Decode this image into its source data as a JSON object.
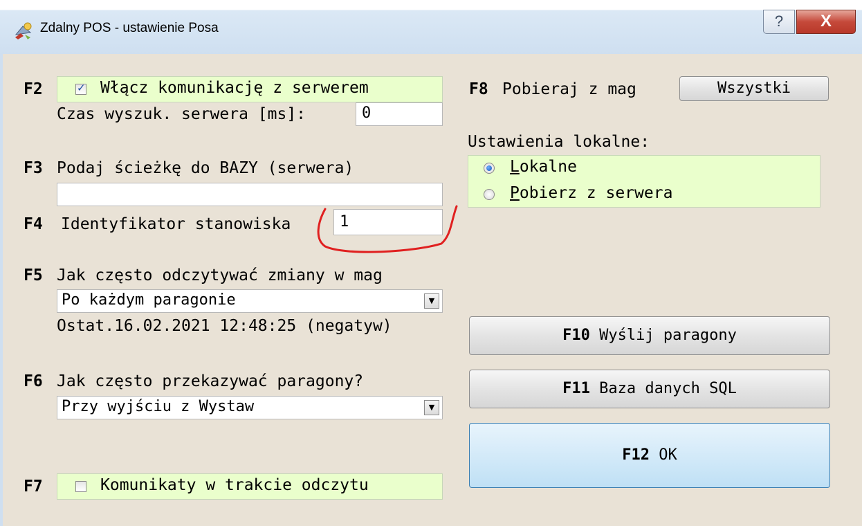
{
  "window": {
    "title": "Zdalny POS - ustawienie Posa",
    "help_label": "?",
    "close_label": "X"
  },
  "f2": {
    "key": "F2",
    "checkbox_checked": true,
    "label": "Włącz komunikację z serwerem",
    "search_label": "Czas wyszuk. serwera [ms]:",
    "search_value": "0"
  },
  "f3": {
    "key": "F3",
    "label": "Podaj ścieżkę do BAZY (serwera)",
    "path_value": ""
  },
  "f4": {
    "key": "F4",
    "label": "Identyfikator stanowiska",
    "id_value": "1"
  },
  "f5": {
    "key": "F5",
    "label": "Jak często odczytywać zmiany w mag",
    "selected": "Po każdym paragonie",
    "last_read": "Ostat.16.02.2021 12:48:25 (negatyw)"
  },
  "f6": {
    "key": "F6",
    "label": "Jak często przekazywać paragony?",
    "selected": "Przy wyjściu z Wystaw"
  },
  "f7": {
    "key": "F7",
    "checkbox_checked": false,
    "label": "Komunikaty w trakcie odczytu"
  },
  "f8": {
    "key": "F8",
    "label": "Pobieraj z mag",
    "button_label": "Wszystki"
  },
  "local_settings": {
    "title": "Ustawienia lokalne:",
    "options": [
      {
        "first": "L",
        "rest": "okalne",
        "selected": true
      },
      {
        "first": "P",
        "rest": "obierz z serwera",
        "selected": false
      }
    ]
  },
  "buttons": {
    "f10_key": "F10",
    "f10_label": "Wyślij paragony",
    "f11_key": "F11",
    "f11_label": "Baza danych SQL",
    "f12_key": "F12",
    "f12_label": "OK"
  },
  "colors": {
    "dialog_bg": "#e9e2d6",
    "highlight_green": "#eaffcc",
    "annotation_red": "#e02020",
    "ok_button": "#bfe0f5"
  }
}
